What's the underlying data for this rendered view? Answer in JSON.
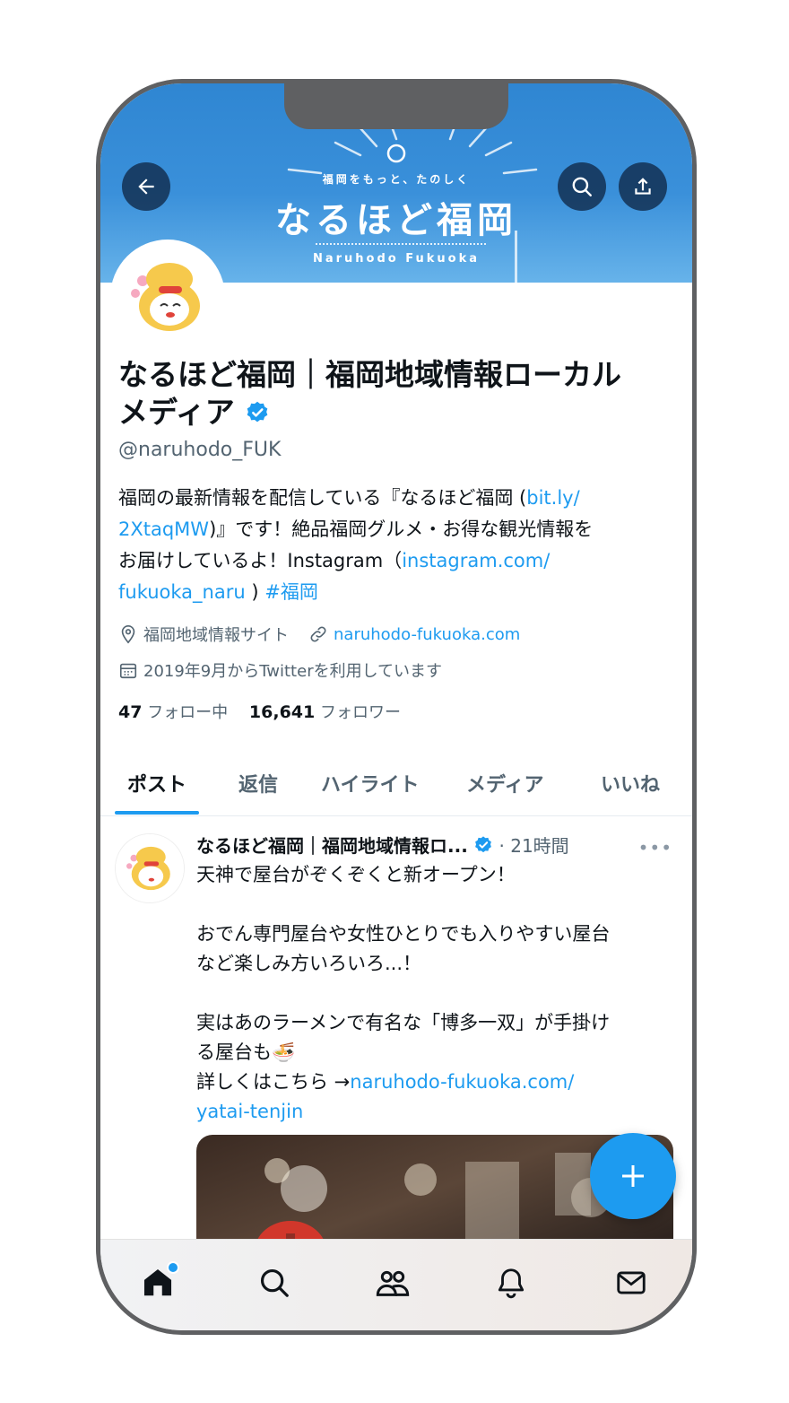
{
  "header": {
    "banner_tagline": "福岡をもっと、たのしく",
    "banner_logo": "なるほど福岡",
    "banner_roman": "Naruhodo Fukuoka",
    "back_icon": "arrow-left-icon",
    "search_icon": "search-icon",
    "share_icon": "share-icon"
  },
  "profile": {
    "name_line1": "なるほど福岡｜福岡地域情報ローカル",
    "name_line2": "メディア",
    "handle": "@naruhodo_FUK",
    "bio": {
      "t1": "福岡の最新情報を配信している『なるほど福岡 (",
      "l1": "bit.ly/",
      "l2": "2XtaqMW",
      "t2": ")』です！絶品福岡グルメ・お得な観光情報を",
      "t3": "お届けしているよ！Instagram（",
      "l3": "instagram.com/",
      "l4": "fukuoka_naru",
      "t4": " ) ",
      "hashtag": "#福岡"
    },
    "location": "福岡地域情報サイト",
    "website": "naruhodo-fukuoka.com",
    "joined": "2019年9月からTwitterを利用しています",
    "following_count": "47",
    "following_label": "フォロー中",
    "followers_count": "16,641",
    "followers_label": "フォロワー"
  },
  "tabs": [
    {
      "label": "ポスト",
      "active": true
    },
    {
      "label": "返信",
      "active": false
    },
    {
      "label": "ハイライト",
      "active": false
    },
    {
      "label": "メディア",
      "active": false
    },
    {
      "label": "いいね",
      "active": false
    }
  ],
  "post": {
    "author": "なるほど福岡｜福岡地域情報ロ...",
    "time": "· 21時間",
    "more": "•••",
    "p1": "天神で屋台がぞくぞくと新オープン！",
    "p2": "おでん専門屋台や女性ひとりでも入りやすい屋台",
    "p3": "など楽しみ方いろいろ...！",
    "p4": "実はあのラーメンで有名な「博多一双」が手掛け",
    "p5": "る屋台も🍜",
    "p6": "詳しくはこちら →",
    "link1": "naruhodo-fukuoka.com/",
    "link2": "yatai-tenjin"
  },
  "fab": {
    "icon": "plus-icon"
  },
  "bottom_nav": [
    {
      "icon": "home-icon"
    },
    {
      "icon": "search-icon"
    },
    {
      "icon": "communities-icon"
    },
    {
      "icon": "bell-icon"
    },
    {
      "icon": "mail-icon"
    }
  ],
  "colors": {
    "accent": "#1d9bf0",
    "text": "#0f1419",
    "muted": "#536471"
  }
}
